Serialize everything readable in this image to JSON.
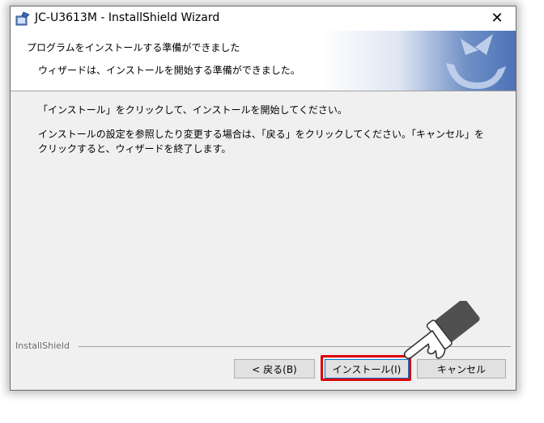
{
  "window": {
    "title": "JC-U3613M - InstallShield Wizard",
    "close_glyph": "✕"
  },
  "banner": {
    "title": "プログラムをインストールする準備ができました",
    "subtitle": "ウィザードは、インストールを開始する準備ができました。"
  },
  "content": {
    "instruction": "「インストール」をクリックして、インストールを開始してください。",
    "note": "インストールの設定を参照したり変更する場合は、「戻る」をクリックしてください。「キャンセル」をクリックすると、ウィザードを終了します。"
  },
  "footer": {
    "brand": "InstallShield"
  },
  "buttons": {
    "back": "< 戻る(B)",
    "install": "インストール(I)",
    "cancel": "キャンセル"
  },
  "colors": {
    "highlight": "#e00000",
    "banner_blue": "#4d72b6"
  },
  "icons": {
    "app": "installer-icon",
    "close": "close-icon",
    "logo": "installshield-logo-icon",
    "pointer": "pointing-hand-icon"
  }
}
